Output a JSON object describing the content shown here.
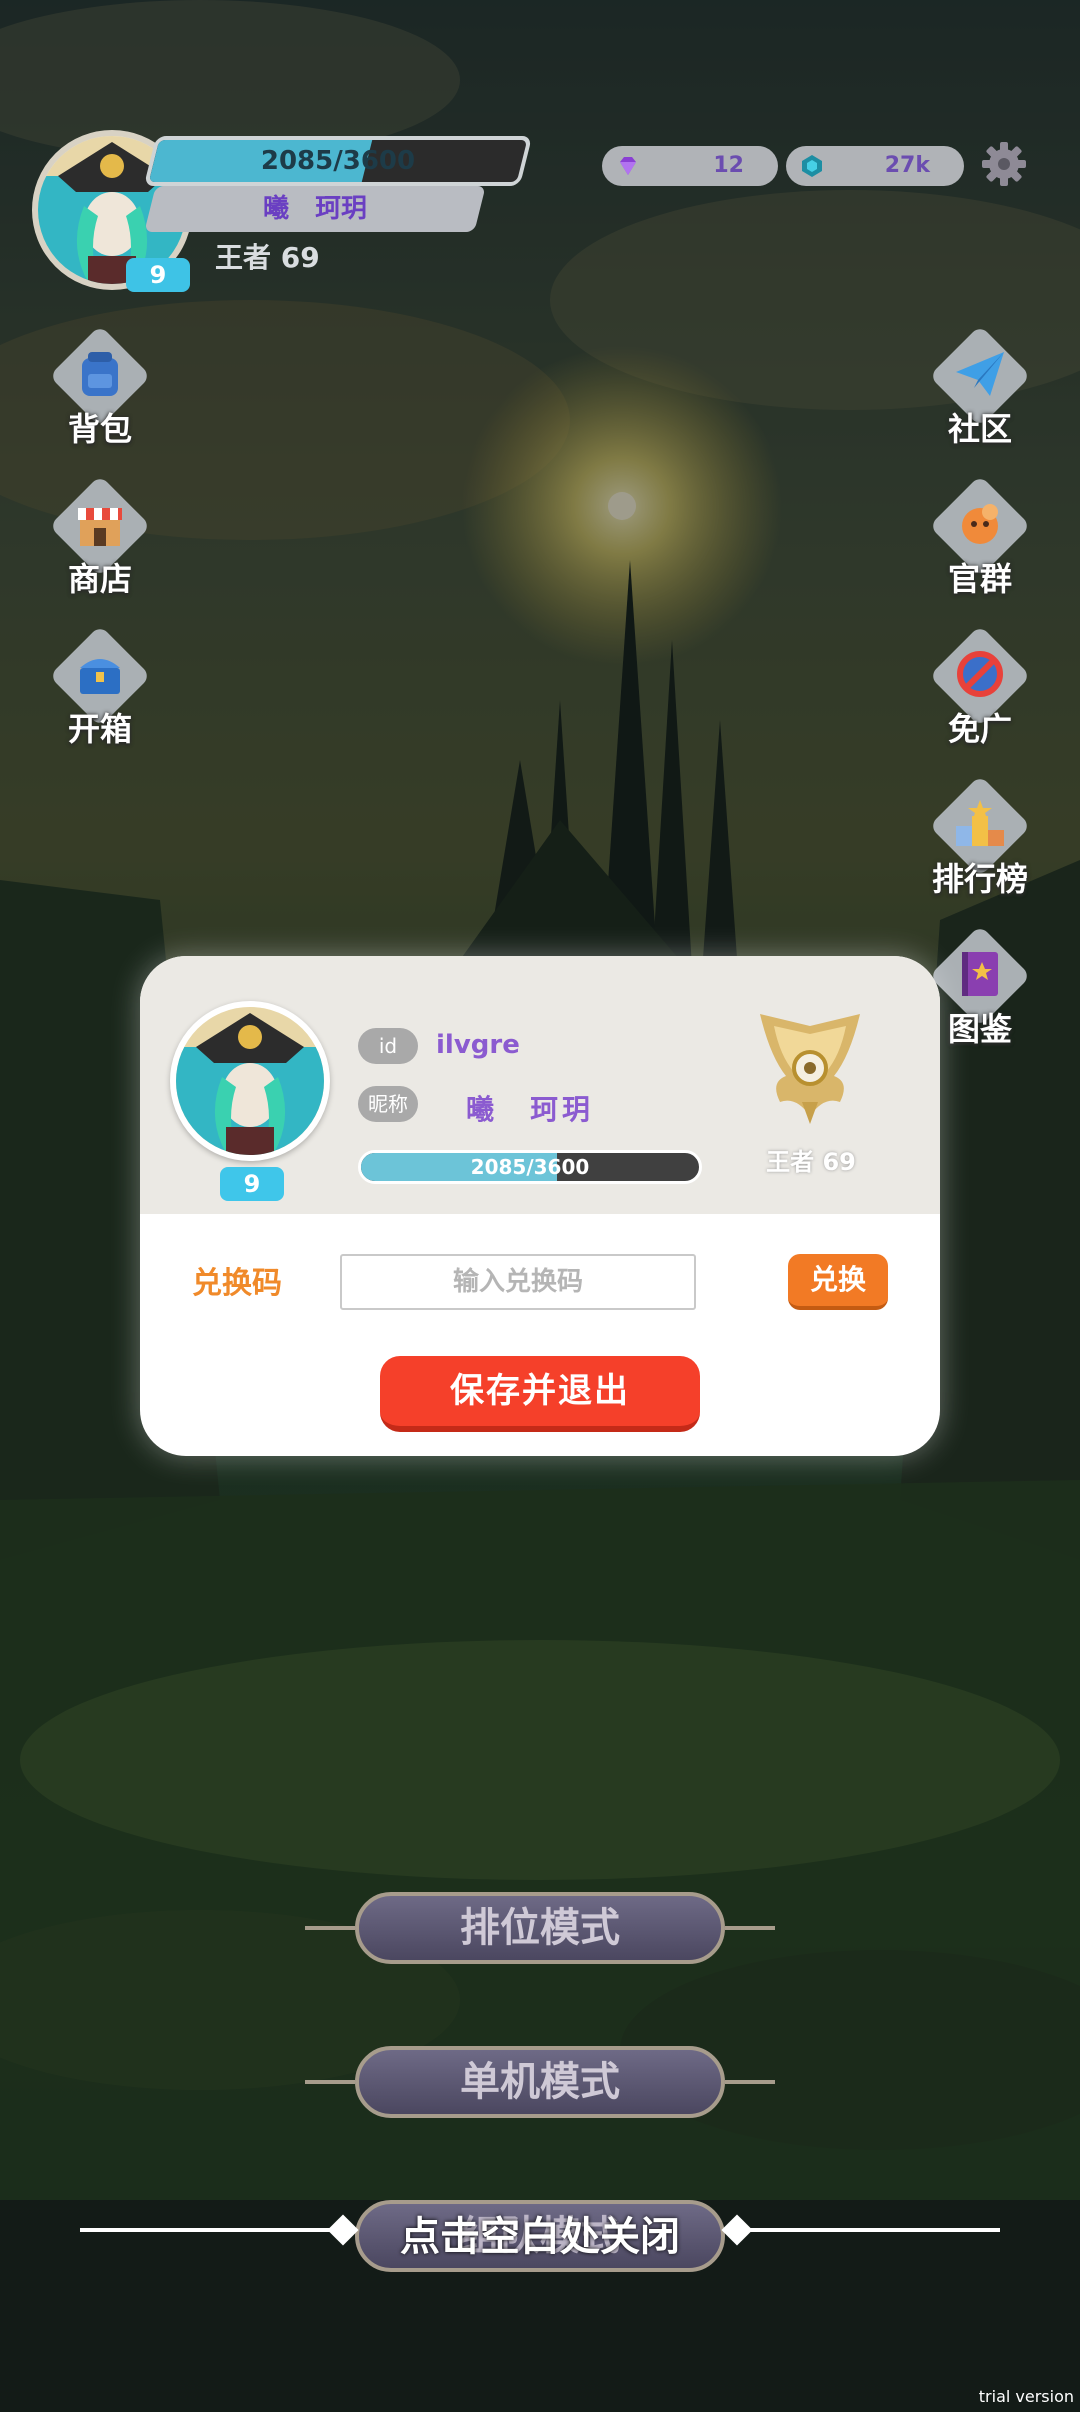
{
  "header": {
    "xp_text": "2085/3600",
    "xp_progress": 0.58,
    "nickname": "曦　珂玥",
    "rank": "王者 69",
    "level": "9"
  },
  "currencies": [
    {
      "name": "gems",
      "value": "12",
      "icon": "gem-icon",
      "color": "#8a3fd4"
    },
    {
      "name": "crystals",
      "value": "27k",
      "icon": "crystal-icon",
      "color": "#1fb4c8"
    }
  ],
  "left_menu": [
    {
      "label": "背包",
      "icon": "backpack-icon"
    },
    {
      "label": "商店",
      "icon": "shop-icon"
    },
    {
      "label": "开箱",
      "icon": "chest-icon"
    }
  ],
  "right_menu": [
    {
      "label": "社区",
      "icon": "paper-plane-icon"
    },
    {
      "label": "官群",
      "icon": "group-chat-icon"
    },
    {
      "label": "免广",
      "icon": "no-ads-icon"
    },
    {
      "label": "排行榜",
      "icon": "leaderboard-icon"
    },
    {
      "label": "图鉴",
      "icon": "book-icon"
    }
  ],
  "modal": {
    "id_label": "id",
    "id_value": "ilvgre",
    "nick_label": "昵称",
    "nick_value": "曦　珂玥",
    "level": "9",
    "xp_text": "2085/3600",
    "xp_progress": 0.58,
    "rank": "王者 69",
    "redeem_label": "兑换码",
    "redeem_placeholder": "输入兑换码",
    "redeem_value": "",
    "redeem_button": "兑换",
    "save_button": "保存并退出"
  },
  "modes": [
    {
      "label": "排位模式"
    },
    {
      "label": "单机模式"
    },
    {
      "label": "组队模式"
    }
  ],
  "close_hint": "点击空白处关闭",
  "watermark": "trial version",
  "colors": {
    "accent_orange": "#f27a25",
    "save_red": "#f5402a",
    "level_blue": "#3fc6ea",
    "name_purple": "#8b5bd0"
  }
}
